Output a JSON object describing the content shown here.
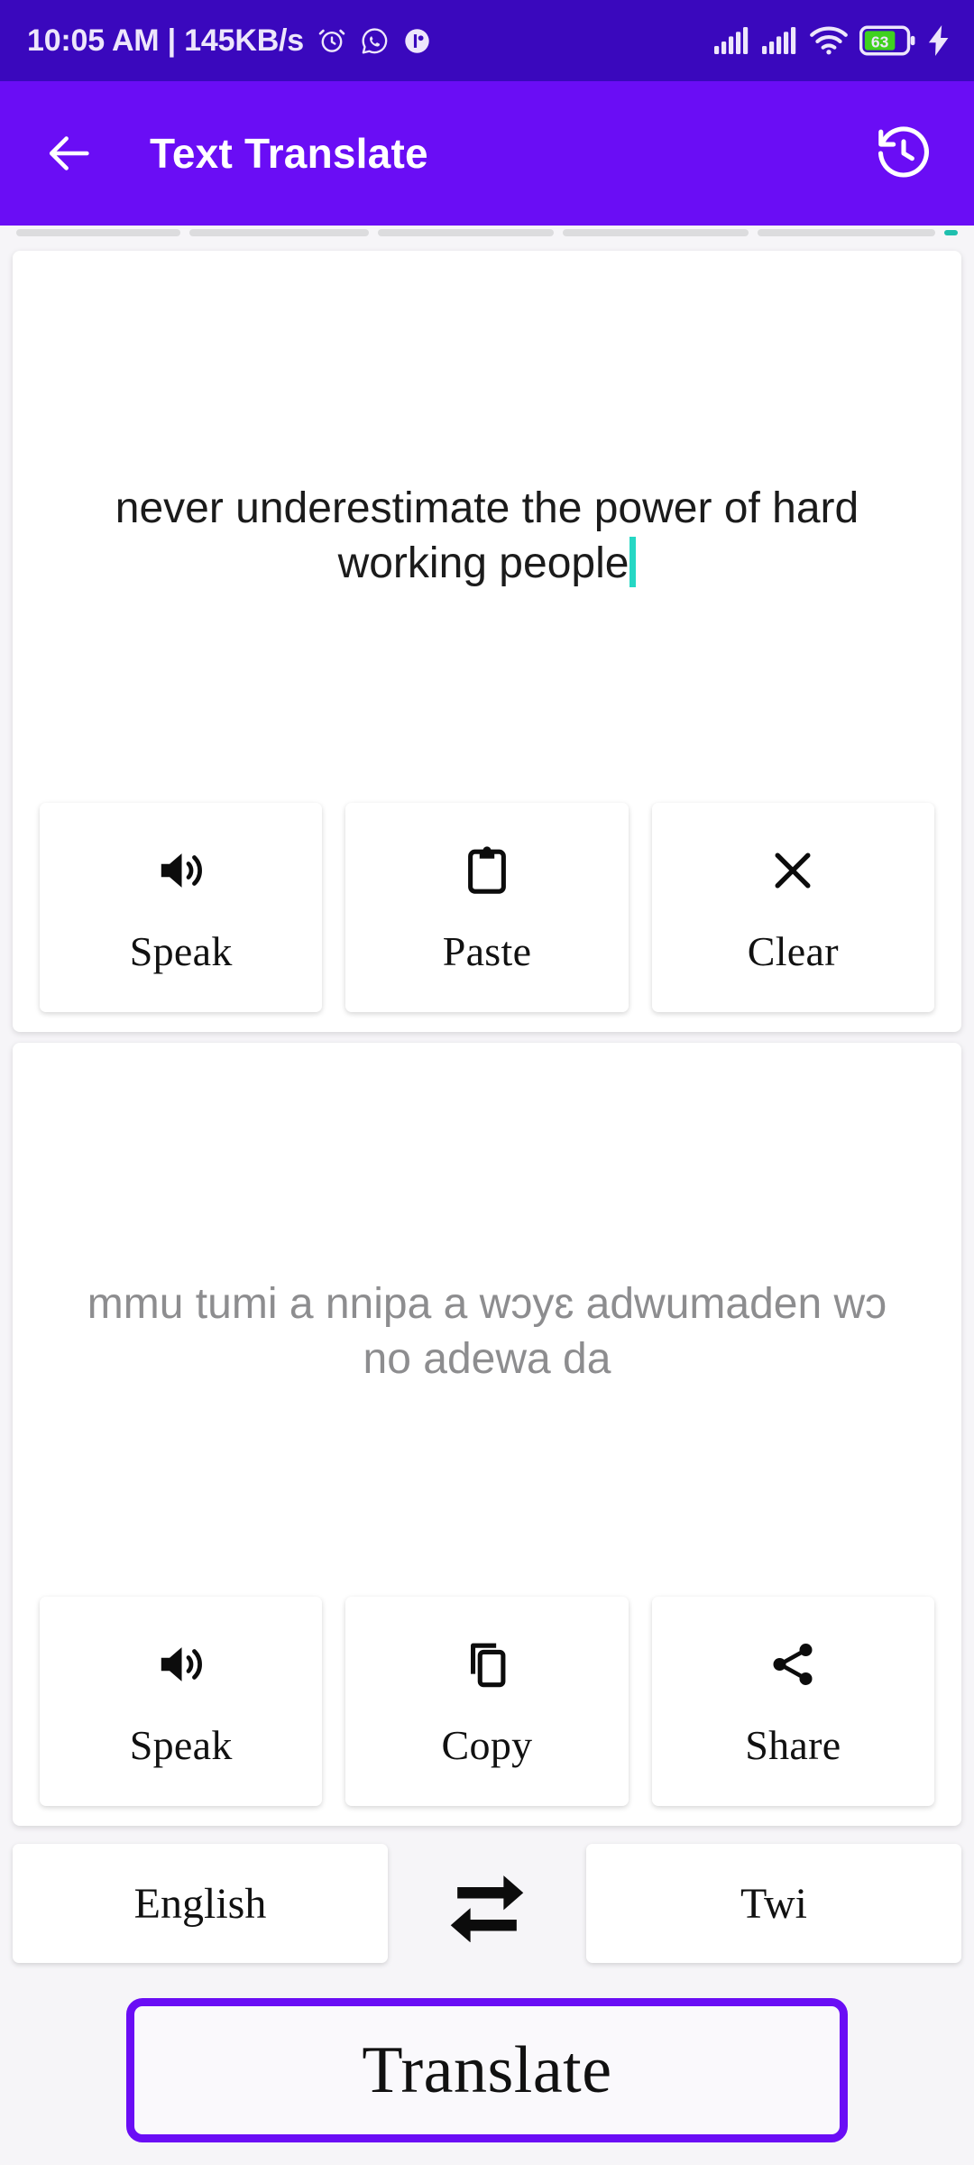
{
  "statusbar": {
    "clock_and_speed": "10:05 AM | 145KB/s",
    "battery_percent": "63",
    "icons": [
      "alarm-icon",
      "whatsapp-icon",
      "app-icon",
      "signal-icon",
      "signal-icon-2",
      "wifi-icon",
      "battery-icon",
      "charging-bolt-icon"
    ]
  },
  "appbar": {
    "title": "Text Translate",
    "back_icon": "back-arrow-icon",
    "history_icon": "history-icon"
  },
  "input_card": {
    "text": "never underestimate the power of hard working people",
    "caret_color": "#26D7C4",
    "actions": [
      {
        "label": "Speak",
        "icon": "volume-icon"
      },
      {
        "label": "Paste",
        "icon": "clipboard-icon"
      },
      {
        "label": "Clear",
        "icon": "close-x-icon"
      }
    ]
  },
  "output_card": {
    "text": "mmu tumi a nnipa a wɔyɛ adwumaden wɔ no adewa da",
    "actions": [
      {
        "label": "Speak",
        "icon": "volume-icon"
      },
      {
        "label": "Copy",
        "icon": "copy-icon"
      },
      {
        "label": "Share",
        "icon": "share-icon"
      }
    ]
  },
  "language_row": {
    "source_language": "English",
    "target_language": "Twi",
    "swap_icon": "swap-arrows-icon"
  },
  "translate_button": {
    "label": "Translate"
  },
  "colors": {
    "statusbar_purple": "#3A08BD",
    "appbar_purple": "#6A0DF5",
    "accent_purple": "#6A0DF5",
    "battery_green": "#3FD11E",
    "caret_teal": "#26D7C4",
    "page_background": "#F6F5F8"
  }
}
